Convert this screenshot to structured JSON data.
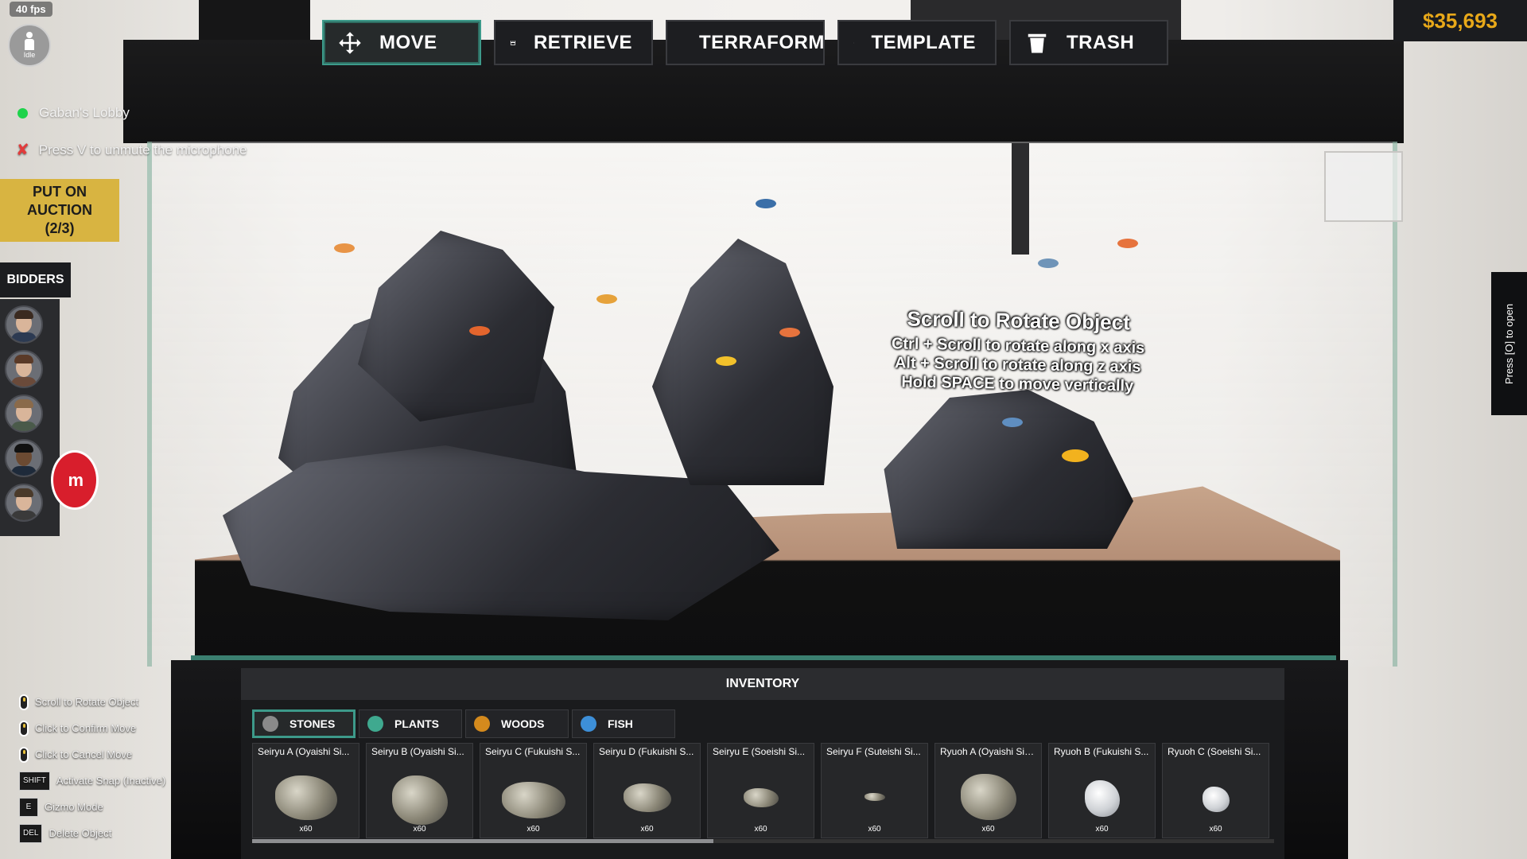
{
  "hud": {
    "fps": "40 fps",
    "status": "Idle",
    "lobby": "Gaban's Lobby",
    "mic_hint": "Press V to unmute the microphone",
    "auction_button": "PUT ON AUCTION (2/3)",
    "bidders_tab": "BIDDERS",
    "badge_text": "m",
    "money": "$35,693",
    "side_tab": "Press [O] to open"
  },
  "toolbar": [
    {
      "label": "MOVE",
      "icon": "move-icon"
    },
    {
      "label": "RETRIEVE",
      "icon": "retrieve-icon"
    },
    {
      "label": "TERRAFORM",
      "icon": "terraform-icon"
    },
    {
      "label": "TEMPLATE",
      "icon": "template-icon"
    },
    {
      "label": "TRASH",
      "icon": "trash-icon"
    }
  ],
  "rotate_hint": {
    "title": "Scroll to Rotate Object",
    "lines": [
      "Ctrl + Scroll to rotate along x axis",
      "Alt + Scroll to rotate along z axis",
      "Hold SPACE to move vertically"
    ]
  },
  "shortcuts": [
    {
      "key": "",
      "label": "Scroll to Rotate Object"
    },
    {
      "key": "",
      "label": "Click to Confirm Move"
    },
    {
      "key": "",
      "label": "Click to Cancel Move"
    },
    {
      "key": "SHIFT",
      "label": "Activate Snap (Inactive)"
    },
    {
      "key": "E",
      "label": "Gizmo Mode"
    },
    {
      "key": "DEL",
      "label": "Delete Object"
    }
  ],
  "inventory": {
    "title": "INVENTORY",
    "tabs": [
      {
        "label": "STONES",
        "color": "#8a8a8a"
      },
      {
        "label": "PLANTS",
        "color": "#3fa98f"
      },
      {
        "label": "WOODS",
        "color": "#d48a1d"
      },
      {
        "label": "FISH",
        "color": "#3d8fd8"
      }
    ],
    "items": [
      {
        "name": "Seiryu A (Oyaishi Si...",
        "qty": "x60"
      },
      {
        "name": "Seiryu B (Oyaishi Si...",
        "qty": "x60"
      },
      {
        "name": "Seiryu C (Fukuishi S...",
        "qty": "x60"
      },
      {
        "name": "Seiryu D (Fukuishi S...",
        "qty": "x60"
      },
      {
        "name": "Seiryu E (Soeishi Si...",
        "qty": "x60"
      },
      {
        "name": "Seiryu F (Suteishi Si...",
        "qty": "x60"
      },
      {
        "name": "Ryuoh A (Oyaishi Siz...",
        "qty": "x60"
      },
      {
        "name": "Ryuoh B (Fukuishi S...",
        "qty": "x60"
      },
      {
        "name": "Ryuoh C (Soeishi Si...",
        "qty": "x60"
      }
    ]
  },
  "colors": {
    "accent": "#3d9a8a",
    "money": "#e8a819",
    "auction": "#d8b441"
  }
}
